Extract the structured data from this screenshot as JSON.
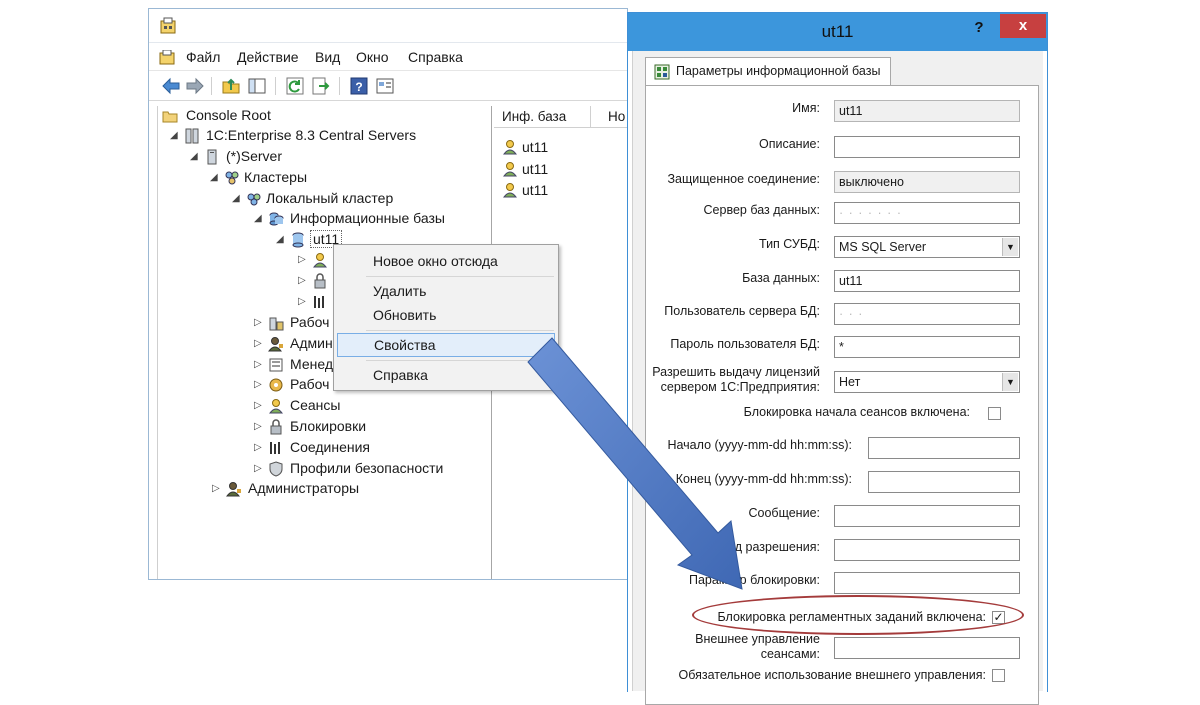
{
  "mmc": {
    "menu": [
      "Файл",
      "Действие",
      "Вид",
      "Окно",
      "Справка"
    ],
    "tree": {
      "console_root": "Console Root",
      "central_servers": "1C:Enterprise 8.3 Central Servers",
      "server": "(*)Server",
      "clusters": "Кластеры",
      "local_cluster": "Локальный кластер",
      "infobases": "Информационные базы",
      "ut11": "ut11",
      "work_servers": "Рабоч",
      "admins_short": "Админ",
      "managers_short": "Менед",
      "work_processes_short": "Рабоч",
      "sessions": "Сеансы",
      "locks": "Блокировки",
      "connections": "Соединения",
      "security_profiles": "Профили безопасности",
      "administrators": "Администраторы"
    },
    "list": {
      "columns": [
        "Инф. база",
        "Но"
      ],
      "rows": [
        "ut11",
        "ut11",
        "ut11"
      ]
    },
    "context_menu": {
      "new_window": "Новое окно отсюда",
      "delete": "Удалить",
      "refresh": "Обновить",
      "properties": "Свойства",
      "help": "Справка"
    }
  },
  "dialog": {
    "title": "ut11",
    "help_label": "?",
    "close_label": "x",
    "tab_label": "Параметры информационной базы",
    "fields": {
      "name_label": "Имя:",
      "name_value": "ut11",
      "description_label": "Описание:",
      "description_value": "",
      "secure_label": "Защищенное соединение:",
      "secure_value": "выключено",
      "dbserver_label": "Сервер баз данных:",
      "dbserver_value": "·  ·  ·  ·  ·  ·  ·",
      "dbms_label": "Тип СУБД:",
      "dbms_value": "MS SQL Server",
      "database_label": "База данных:",
      "database_value": "ut11",
      "dbuser_label": "Пользователь сервера БД:",
      "dbuser_value": "·  ·  ·",
      "dbpassword_label": "Пароль пользователя БД:",
      "dbpassword_value": "*",
      "license_label": "Разрешить выдачу лицензий сервером 1С:Предприятия:",
      "license_value": "Нет",
      "session_lock_label": "Блокировка начала сеансов включена:",
      "start_label": "Начало (yyyy-mm-dd hh:mm:ss):",
      "end_label": "Конец (yyyy-mm-dd hh:mm:ss):",
      "message_label": "Сообщение:",
      "permission_code_label": "Код разрешения:",
      "lock_param_label": "Параметр блокировки:",
      "scheduled_lock_label": "Блокировка регламентных заданий включена:",
      "ext_session_label": "Внешнее управление сеансами:",
      "ext_mandatory_label": "Обязательное использование внешнего управления:"
    },
    "scheduled_lock_checked": "✓"
  },
  "colors": {
    "dialog_title_bg": "#3c96dc",
    "close_bg": "#c74040",
    "annotation_arrow": "#4f79c6",
    "annotation_ellipse": "#a43b3b"
  }
}
